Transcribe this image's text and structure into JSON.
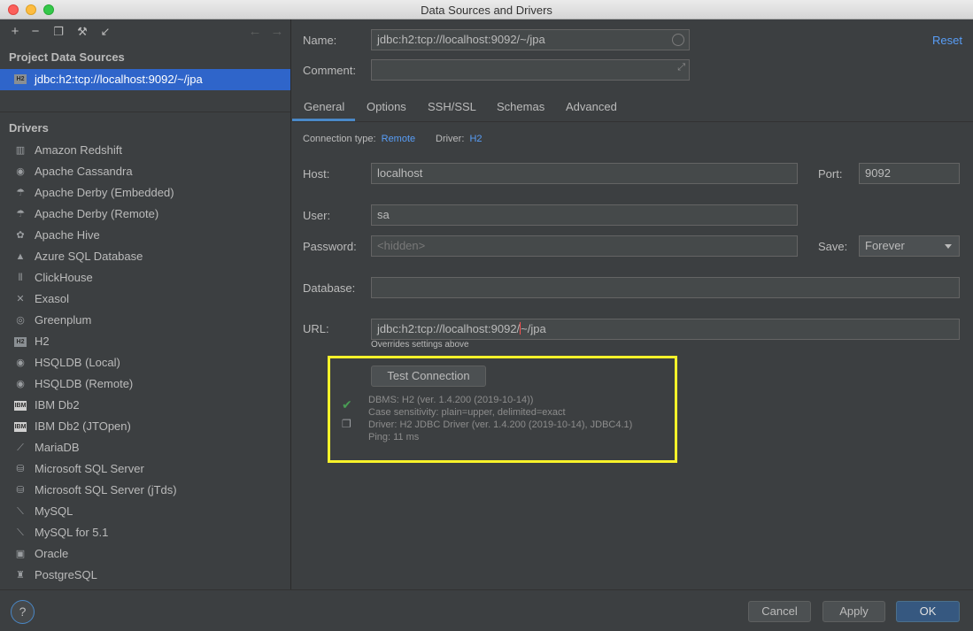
{
  "window": {
    "title": "Data Sources and Drivers"
  },
  "left": {
    "project_label": "Project Data Sources",
    "data_source": {
      "icon": "h2-icon",
      "icon_text": "H2",
      "label": "jdbc:h2:tcp://localhost:9092/~/jpa"
    },
    "drivers_label": "Drivers",
    "drivers": [
      {
        "label": "Amazon Redshift",
        "icon": "redshift-icon",
        "glyph": "▥"
      },
      {
        "label": "Apache Cassandra",
        "icon": "cassandra-icon",
        "glyph": "◉"
      },
      {
        "label": "Apache Derby (Embedded)",
        "icon": "derby-icon",
        "glyph": "☂"
      },
      {
        "label": "Apache Derby (Remote)",
        "icon": "derby-icon",
        "glyph": "☂"
      },
      {
        "label": "Apache Hive",
        "icon": "hive-icon",
        "glyph": "✿"
      },
      {
        "label": "Azure SQL Database",
        "icon": "azure-icon",
        "glyph": "▲"
      },
      {
        "label": "ClickHouse",
        "icon": "clickhouse-icon",
        "glyph": "⦀"
      },
      {
        "label": "Exasol",
        "icon": "exasol-icon",
        "glyph": "✕"
      },
      {
        "label": "Greenplum",
        "icon": "greenplum-icon",
        "glyph": "◎"
      },
      {
        "label": "H2",
        "icon": "h2-icon",
        "glyph": "H2"
      },
      {
        "label": "HSQLDB (Local)",
        "icon": "hsqldb-icon",
        "glyph": "◉"
      },
      {
        "label": "HSQLDB (Remote)",
        "icon": "hsqldb-icon",
        "glyph": "◉"
      },
      {
        "label": "IBM Db2",
        "icon": "ibm-icon",
        "glyph": "IBM"
      },
      {
        "label": "IBM Db2 (JTOpen)",
        "icon": "ibm-icon",
        "glyph": "IBM"
      },
      {
        "label": "MariaDB",
        "icon": "mariadb-icon",
        "glyph": "⟋"
      },
      {
        "label": "Microsoft SQL Server",
        "icon": "sqlserver-icon",
        "glyph": "⛁"
      },
      {
        "label": "Microsoft SQL Server (jTds)",
        "icon": "sqlserver-icon",
        "glyph": "⛁"
      },
      {
        "label": "MySQL",
        "icon": "mysql-icon",
        "glyph": "⟍"
      },
      {
        "label": "MySQL for 5.1",
        "icon": "mysql-icon",
        "glyph": "⟍"
      },
      {
        "label": "Oracle",
        "icon": "oracle-icon",
        "glyph": "▣"
      },
      {
        "label": "PostgreSQL",
        "icon": "postgresql-icon",
        "glyph": "♜"
      }
    ]
  },
  "form": {
    "name_label": "Name:",
    "name_value": "jdbc:h2:tcp://localhost:9092/~/jpa",
    "comment_label": "Comment:",
    "comment_value": "",
    "reset_label": "Reset",
    "tabs": [
      "General",
      "Options",
      "SSH/SSL",
      "Schemas",
      "Advanced"
    ],
    "connection_type_label": "Connection type:",
    "connection_type_value": "Remote",
    "driver_label": "Driver:",
    "driver_value": "H2",
    "host_label": "Host:",
    "host_value": "localhost",
    "port_label": "Port:",
    "port_value": "9092",
    "user_label": "User:",
    "user_value": "sa",
    "password_label": "Password:",
    "password_placeholder": "<hidden>",
    "save_label": "Save:",
    "save_value": "Forever",
    "database_label": "Database:",
    "database_value": "",
    "url_label": "URL:",
    "url_value_before": "jdbc:h2:tcp://localhost:9092/",
    "url_value_after": "~/jpa",
    "url_hint": "Overrides settings above",
    "test_button": "Test Connection",
    "result": {
      "dbms": "DBMS: H2 (ver. 1.4.200 (2019-10-14))",
      "case": "Case sensitivity: plain=upper, delimited=exact",
      "driver": "Driver: H2 JDBC Driver (ver. 1.4.200 (2019-10-14), JDBC4.1)",
      "ping": "Ping: 11 ms"
    }
  },
  "footer": {
    "help_label": "?",
    "cancel_label": "Cancel",
    "apply_label": "Apply",
    "ok_label": "OK"
  },
  "colors": {
    "accent": "#589df6",
    "selection": "#2f65ca",
    "highlight_box": "#f8f22a",
    "success": "#499c54"
  }
}
